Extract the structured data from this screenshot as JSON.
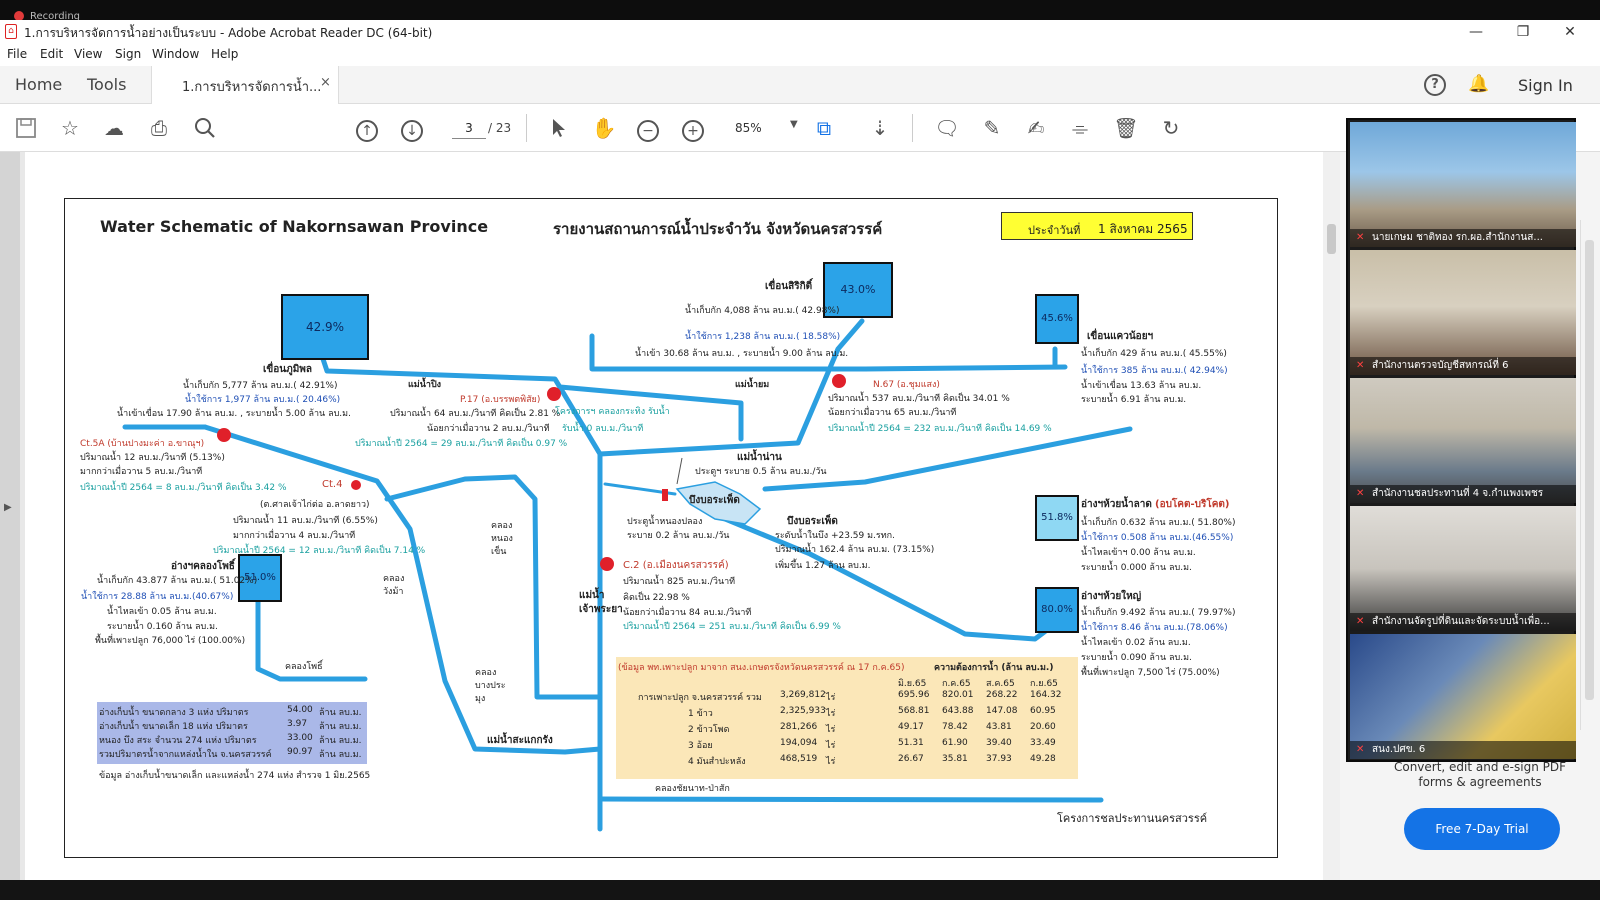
{
  "recording": {
    "label": "Recording"
  },
  "window": {
    "title": "1.การบริหารจัดการน้ำอย่างเป็นระบบ - Adobe Acrobat Reader DC (64-bit)",
    "minimize": "—",
    "restore": "❐",
    "close": "✕"
  },
  "menu": {
    "file": "File",
    "edit": "Edit",
    "view": "View",
    "sign": "Sign",
    "window": "Window",
    "help": "Help"
  },
  "tabs": {
    "home": "Home",
    "tools": "Tools",
    "doc": "1.การบริหารจัดการน้ำ...",
    "doc_close": "×"
  },
  "header": {
    "help": "?",
    "sign_in": "Sign In"
  },
  "toolbar": {
    "page_current": "3",
    "page_total": "/ 23",
    "zoom": "85%"
  },
  "rightpanel": {
    "convert_text": "Convert, edit and e-sign PDF forms & agreements",
    "trial_button": "Free 7-Day Trial"
  },
  "video_participants": [
    {
      "name": "นายเกษม ชาติทอง รก.ผอ.สำนักงานส..."
    },
    {
      "name": "สำนักงานตรวจบัญชีสหกรณ์ที่ 6"
    },
    {
      "name": "สำนักงานชลประทานที่ 4 จ.กำแพงเพชร"
    },
    {
      "name": "สำนักงานจัดรูปที่ดินและจัดระบบน้ำเพื่อ..."
    },
    {
      "name": "สนง.ปศข. 6"
    }
  ],
  "doc": {
    "title_en": "Water Schematic of Nakornsawan Province",
    "title_th": "รายงานสถานการณ์น้ำประจำวัน จังหวัดนครสวรรค์",
    "date_label": "ประจำวันที่",
    "date_value": "1 สิงหาคม 2565",
    "dams": {
      "bhumibol": {
        "pct": "42.9%",
        "name": "เขื่อนภูมิพล",
        "l1": "น้ำเก็บกัก 5,777 ล้าน ลบ.ม.( 42.91%)",
        "l2": "น้ำใช้การ 1,977 ล้าน ลบ.ม.( 20.46%)",
        "l3": "น้ำเข้าเขื่อน 17.90 ล้าน ลบ.ม. , ระบายน้ำ 5.00 ล้าน ลบ.ม."
      },
      "sirikit": {
        "pct": "43.0%",
        "name": "เขื่อนสิริกิติ์",
        "l1": "น้ำเก็บกัก 4,088 ล้าน ลบ.ม.( 42.98%)",
        "l2": "น้ำใช้การ 1,238 ล้าน ลบ.ม.( 18.58%)",
        "l3": "น้ำเข้า 30.68 ล้าน ลบ.ม. , ระบายน้ำ 9.00 ล้าน ลบ.ม."
      },
      "kwaenoi": {
        "pct": "45.6%",
        "name": "เขื่อนแควน้อยฯ",
        "l1": "น้ำเก็บกัก 429 ล้าน ลบ.ม.( 45.55%)",
        "l2": "น้ำใช้การ 385 ล้าน ลบ.ม.( 42.94%)",
        "l3": "น้ำเข้าเขื่อน 13.63 ล้าน ลบ.ม.",
        "l4": "ระบายน้ำ 6.91 ล้าน ลบ.ม."
      },
      "klongpho": {
        "pct": "51.0%",
        "name": "อ่างฯคลองโพธิ์",
        "l1": "น้ำเก็บกัก 43.877 ล้าน ลบ.ม.( 51.02%)",
        "l2": "น้ำใช้การ 28.88 ล้าน ลบ.ม.(40.67%)",
        "l3": "น้ำไหลเข้า 0.05 ล้าน ลบ.ม.",
        "l4": "ระบายน้ำ 0.160 ล้าน ลบ.ม.",
        "l5": "พื้นที่เพาะปลูก 76,000 ไร่ (100.00%)"
      },
      "huaynamlad": {
        "pct": "51.8%",
        "name": "อ่างฯห้วยน้ำลาด",
        "name_note": "(อบโคต-บริโคต)",
        "l1": "น้ำเก็บกัก 0.632 ล้าน ลบ.ม.( 51.80%)",
        "l2": "น้ำใช้การ 0.508 ล้าน ลบ.ม.(46.55%)",
        "l3": "น้ำไหลเข้าฯ 0.00 ล้าน ลบ.ม.",
        "l4": "ระบายน้ำ 0.000 ล้าน ลบ.ม."
      },
      "huayyai": {
        "pct": "80.0%",
        "name": "อ่างฯห้วยใหญ่",
        "l1": "น้ำเก็บกัก 9.492 ล้าน ลบ.ม.( 79.97%)",
        "l2": "น้ำใช้การ 8.46 ล้าน ลบ.ม.(78.06%)",
        "l3": "น้ำไหลเข้า 0.02 ล้าน ลบ.ม.",
        "l4": "ระบายน้ำ 0.090 ล้าน ลบ.ม.",
        "l5": "พื้นที่เพาะปลูก 7,500 ไร่ (75.00%)"
      }
    },
    "stations": {
      "p17": {
        "name": "P.17 (อ.บรรพตพิสัย)",
        "l1": "ปริมาณน้ำ 64 ลบ.ม./วินาที คิดเป็น 2.81 %",
        "l2": "น้อยกว่าเมื่อวาน 2 ลบ.ม./วินาที",
        "l3": "ปริมาณน้ำปี 2564 = 29 ลบ.ม./วินาที คิดเป็น 0.97 %"
      },
      "n67": {
        "name": "N.67 (อ.ชุมแสง)",
        "l1": "ปริมาณน้ำ 537 ลบ.ม./วินาที  คิดเป็น 34.01 %",
        "l2": "น้อยกว่าเมื่อวาน 65 ลบ.ม./วินาที",
        "l3": "ปริมาณน้ำปี 2564 = 232 ลบ.ม./วินาที  คิดเป็น 14.69 %"
      },
      "ct5a": {
        "name": "Ct.5A (บ้านปางมะค่า อ.ขาณุฯ)",
        "l1": "ปริมาณน้ำ 12 ลบ.ม./วินาที (5.13%)",
        "l2": "มากกว่าเมื่อวาน 5 ลบ.ม./วินาที",
        "l3": "ปริมาณน้ำปี 2564 = 8 ลบ.ม./วินาที คิดเป็น 3.42 %"
      },
      "ct4": {
        "name": "Ct.4",
        "loc": "(ต.ศาลเจ้าไก่ต่อ อ.ลาดยาว)",
        "l1": "ปริมาณน้ำ 11 ลบ.ม./วินาที (6.55%)",
        "l2": "มากกว่าเมื่อวาน 4 ลบ.ม./วินาที",
        "l3": "ปริมาณน้ำปี 2564 = 12 ลบ.ม./วินาที คิดเป็น 7.14 %"
      },
      "c2": {
        "name": "C.2 (อ.เมืองนครสวรรค์)",
        "l1": "ปริมาณน้ำ 825 ลบ.ม./วินาที",
        "l2": "คิดเป็น 22.98 %",
        "l3": "น้อยกว่าเมื่อวาน 84 ลบ.ม./วินาที",
        "l4": "ปริมาณน้ำปี 2564 = 251 ลบ.ม./วินาที  คิดเป็น 6.99 %"
      }
    },
    "labels": {
      "mae_ping": "แม่น้ำปิง",
      "mae_yom": "แม่น้ำยม",
      "mae_nan": "แม่น้ำน่าน",
      "nan_note": "ประตูฯ ระบาย 0.5 ล้าน ลบ.ม./วัน",
      "project": "โครงการฯ คลองกระทิง รับน้ำ",
      "project_l2": "รับน้ำ 0 ลบ.ม./วินาที",
      "bueng": "บึงบอระเพ็ด",
      "gate": "ประตูน้ำหนองปลอง",
      "gate_l2": "ระบาย 0.2 ล้าน ลบ.ม./วัน",
      "bueng2": "บึงบอระเพ็ด",
      "bueng_l1": "ระดับน้ำในบึง +23.59 ม.รทก.",
      "bueng_l2": "ปริมาณน้ำ 162.4 ล้าน ลบ.ม. (73.15%)",
      "bueng_l3": "เพิ่มขึ้น 1.27 ล้าน ลบ.ม.",
      "klong_nongkhen": "คลองหนองเข็น",
      "klong_wang": "คลองวังม้า",
      "klong_pho": "คลองโพธิ์",
      "klong_bangprong": "คลองบางประมุง",
      "chao_phraya": "แม่น้ำเจ้าพระยา",
      "mae_sakaekrang": "แม่น้ำสะแกกรัง",
      "klong_chainat": "คลองชัยนาท-ป่าสัก",
      "footer": "โครงการชลประทานนครสวรรค์"
    },
    "summary": {
      "rows": [
        {
          "label": "อ่างเก็บน้ำ ขนาดกลาง 3 แห่ง ปริมาตร",
          "value": "54.00",
          "unit": "ล้าน ลบ.ม."
        },
        {
          "label": "อ่างเก็บน้ำ ขนาดเล็ก 18 แห่ง ปริมาตร",
          "value": "3.97",
          "unit": "ล้าน ลบ.ม."
        },
        {
          "label": "หนอง บึง สระ จำนวน 274 แห่ง ปริมาตร",
          "value": "33.00",
          "unit": "ล้าน ลบ.ม."
        },
        {
          "label": "รวมปริมาตรน้ำจากแหล่งน้ำใน จ.นครสวรรค์",
          "value": "90.97",
          "unit": "ล้าน ลบ.ม."
        }
      ],
      "note": "ข้อมูล อ่างเก็บน้ำขนาดเล็ก และแหล่งน้ำ 274 แห่ง สำรวจ 1 มิย.2565"
    },
    "crop": {
      "source": "(ข้อมูล พท.เพาะปลูก มาจาก สนง.เกษตรจังหวัดนครสวรรค์ ณ 17 ก.ค.65)",
      "need_header": "ความต้องการน้ำ (ล้าน ลบ.ม.)",
      "months": [
        "มิ.ย.65",
        "ก.ค.65",
        "ส.ค.65",
        "ก.ย.65"
      ],
      "rows": [
        {
          "label": "การเพาะปลูก จ.นครสวรรค์ รวม",
          "area": "3,269,812",
          "u": "ไร่",
          "v": [
            "695.96",
            "820.01",
            "268.22",
            "164.32"
          ]
        },
        {
          "label": "1 ข้าว",
          "area": "2,325,933",
          "u": "ไร่",
          "v": [
            "568.81",
            "643.88",
            "147.08",
            "60.95"
          ]
        },
        {
          "label": "2 ข้าวโพด",
          "area": "281,266",
          "u": "ไร่",
          "v": [
            "49.17",
            "78.42",
            "43.81",
            "20.60"
          ]
        },
        {
          "label": "3 อ้อย",
          "area": "194,094",
          "u": "ไร่",
          "v": [
            "51.31",
            "61.90",
            "39.40",
            "33.49"
          ]
        },
        {
          "label": "4 มันสำปะหลัง",
          "area": "468,519",
          "u": "ไร่",
          "v": [
            "26.67",
            "35.81",
            "37.93",
            "49.28"
          ]
        }
      ]
    }
  },
  "colors": {
    "river": "#2b9fe0",
    "dam": "#2ba3e8",
    "accent": "#1473e6",
    "station": "#e0202a"
  }
}
